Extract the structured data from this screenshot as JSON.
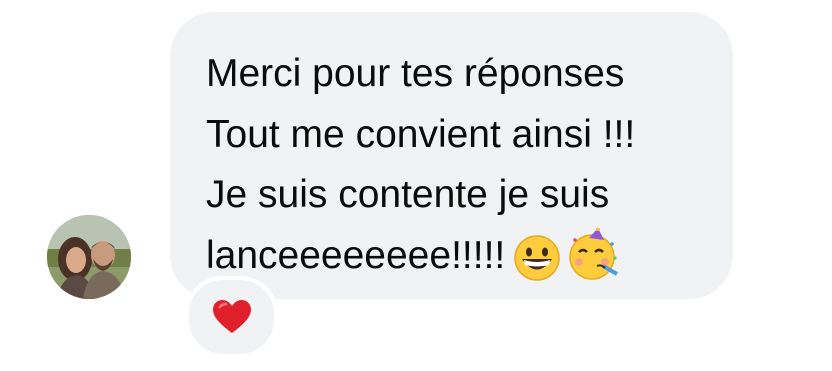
{
  "message": {
    "lines": [
      "Merci pour tes réponses",
      "Tout me convient ainsi !!!",
      "Je suis contente je suis",
      "lanceeeeeeee!!!!!"
    ],
    "emojis": [
      "grinning-face-emoji",
      "partying-face-emoji"
    ]
  },
  "reaction": {
    "icon": "red-heart-icon",
    "color": "#e0202b"
  },
  "colors": {
    "bubble": "#f1f2f4",
    "text": "#0b0b0b"
  }
}
